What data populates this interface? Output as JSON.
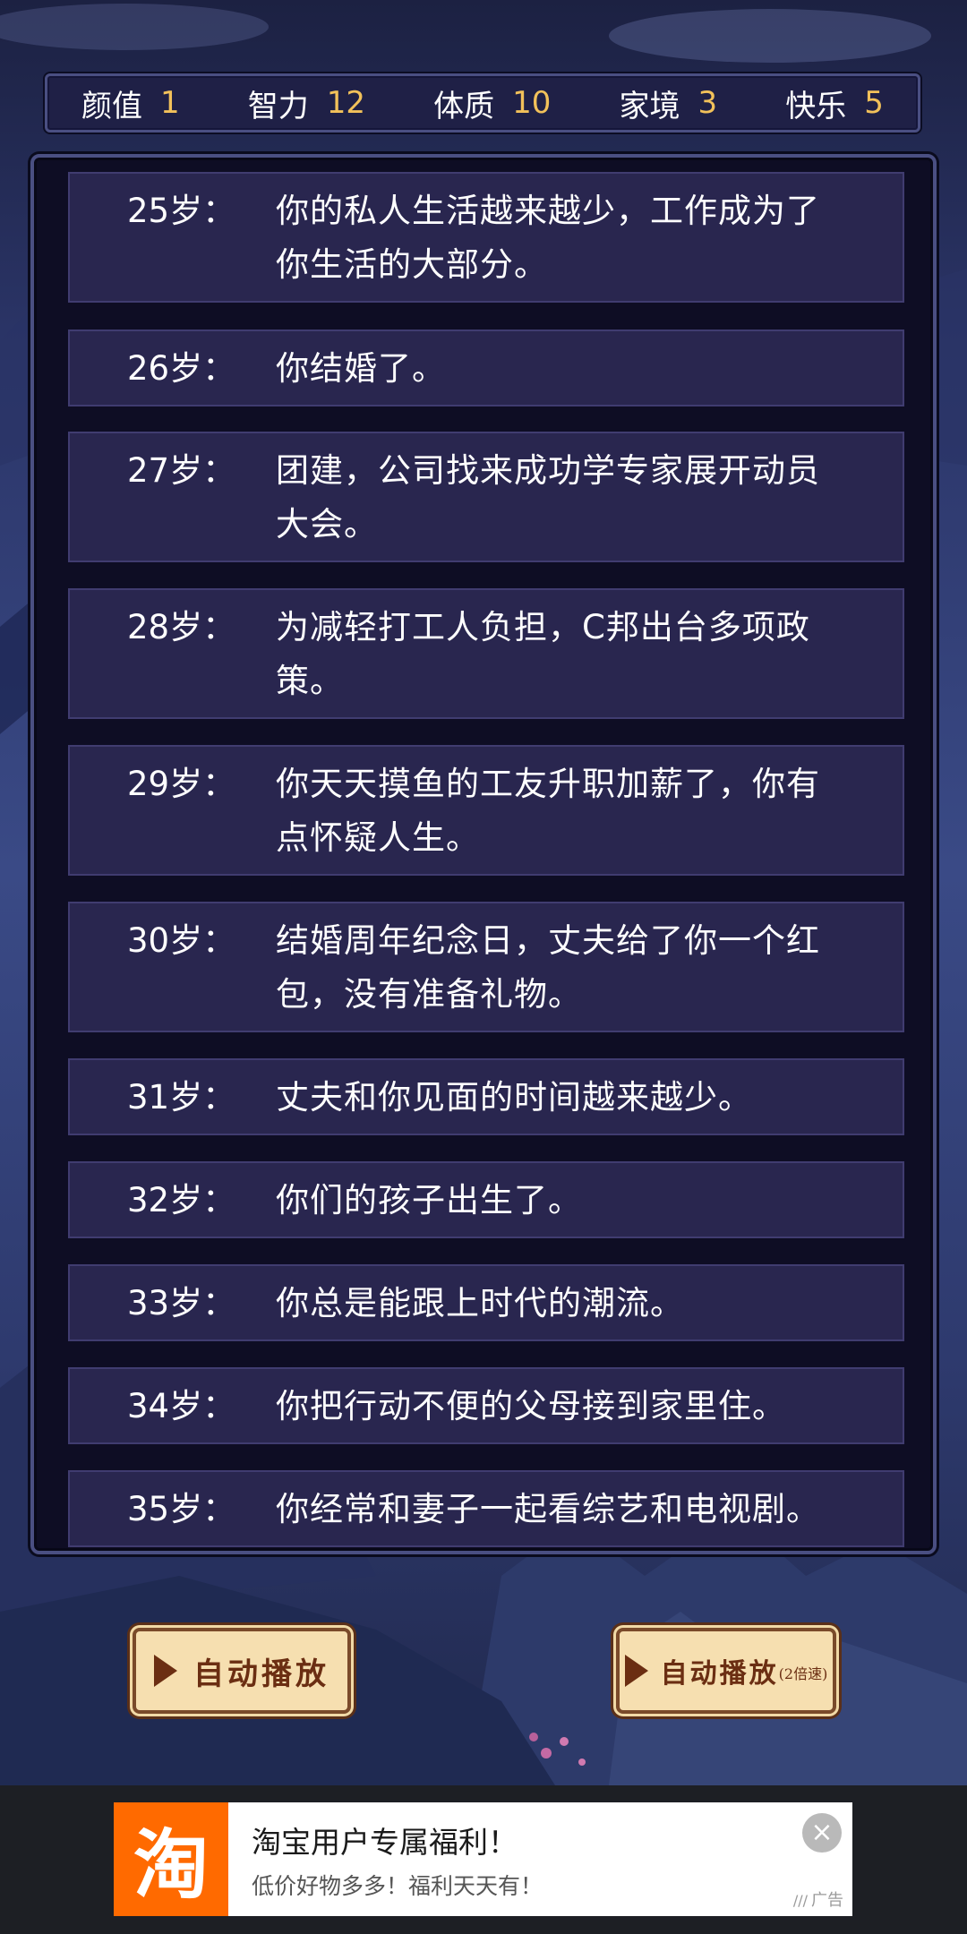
{
  "stats": [
    {
      "label": "颜值",
      "value": "1"
    },
    {
      "label": "智力",
      "value": "12"
    },
    {
      "label": "体质",
      "value": "10"
    },
    {
      "label": "家境",
      "value": "3"
    },
    {
      "label": "快乐",
      "value": "5"
    }
  ],
  "events": [
    {
      "age": "25岁：",
      "text": "你的私人生活越来越少，工作成为了你生活的大部分。"
    },
    {
      "age": "26岁：",
      "text": "你结婚了。"
    },
    {
      "age": "27岁：",
      "text": "团建，公司找来成功学专家展开动员大会。"
    },
    {
      "age": "28岁：",
      "text": "为减轻打工人负担，C邦出台多项政策。"
    },
    {
      "age": "29岁：",
      "text": "你天天摸鱼的工友升职加薪了，你有点怀疑人生。"
    },
    {
      "age": "30岁：",
      "text": "结婚周年纪念日，丈夫给了你一个红包，没有准备礼物。"
    },
    {
      "age": "31岁：",
      "text": "丈夫和你见面的时间越来越少。"
    },
    {
      "age": "32岁：",
      "text": "你们的孩子出生了。"
    },
    {
      "age": "33岁：",
      "text": "你总是能跟上时代的潮流。"
    },
    {
      "age": "34岁：",
      "text": "你把行动不便的父母接到家里住。"
    },
    {
      "age": "35岁：",
      "text": "你经常和妻子一起看综艺和电视剧。"
    }
  ],
  "buttons": {
    "auto_play": "自动播放",
    "auto_play_fast": "自动播放",
    "auto_play_fast_sub": "(2倍速)"
  },
  "ad": {
    "logo": "淘",
    "title": "淘宝用户专属福利！",
    "desc": "低价好物多多！福利天天有！",
    "tag": "广告",
    "close": "×"
  }
}
